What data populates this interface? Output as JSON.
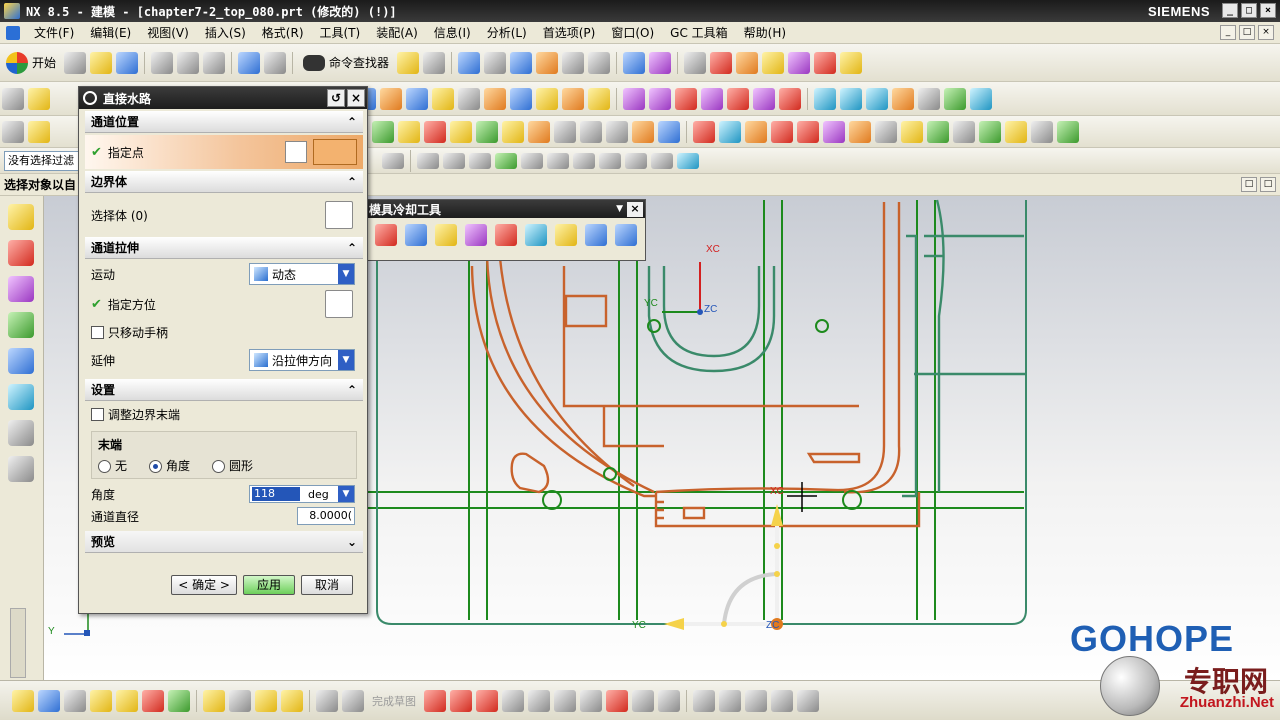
{
  "window": {
    "title": "NX 8.5 - 建模 - [chapter7-2_top_080.prt (修改的) (!)]",
    "brand": "SIEMENS",
    "controls": [
      "_",
      "□",
      "×"
    ]
  },
  "menubar": {
    "items": [
      "文件(F)",
      "编辑(E)",
      "视图(V)",
      "插入(S)",
      "格式(R)",
      "工具(T)",
      "装配(A)",
      "信息(I)",
      "分析(L)",
      "首选项(P)",
      "窗口(O)",
      "GC 工具箱",
      "帮助(H)"
    ],
    "mdi_controls": [
      "_",
      "□",
      "×"
    ]
  },
  "toolbar": {
    "start_label": "开始",
    "command_finder_label": "命令查找器"
  },
  "selection": {
    "filter_text": "没有选择过滤",
    "status_text": "选择对象以自"
  },
  "dialog": {
    "title": "直接水路",
    "sections": {
      "channel_position": "通道位置",
      "boundary_body": "边界体",
      "channel_extrude": "通道拉伸",
      "settings": "设置",
      "preview": "预览"
    },
    "specify_point_label": "指定点",
    "select_body_label": "选择体 (0)",
    "motion_label": "运动",
    "motion_value": "动态",
    "specify_orientation_label": "指定方位",
    "move_handle_only_label": "只移动手柄",
    "extend_label": "延伸",
    "extend_value": "沿拉伸方向",
    "adjust_boundary_end_label": "调整边界末端",
    "end_group_title": "末端",
    "end_options": [
      "无",
      "角度",
      "圆形"
    ],
    "end_selected": "角度",
    "angle_label": "角度",
    "angle_value": "118",
    "angle_unit": "deg",
    "diameter_label": "通道直径",
    "diameter_value": "8.0000(",
    "buttons": {
      "ok": "< 确定 >",
      "apply": "应用",
      "cancel": "取消"
    }
  },
  "floating_toolbar": {
    "title": "模具冷却工具"
  },
  "bottombar": {
    "finish_sketch_label": "完成草图"
  },
  "viewport": {
    "wcs_labels": {
      "xc": "XC",
      "yc": "YC",
      "zc": "ZC"
    },
    "handle_labels": {
      "xc": "XC",
      "yc": "YC",
      "zc": "ZC"
    },
    "triad_label": "Y"
  },
  "watermark": {
    "brand": "GOHOPE",
    "site": "Zhuanzhi.Net",
    "cn": "专职网"
  },
  "colors": {
    "geometry_orange": "#c8622c",
    "geometry_green": "#1d8a1d",
    "channel_teal": "#3a8a6a",
    "accent_blue": "#2456b8"
  }
}
